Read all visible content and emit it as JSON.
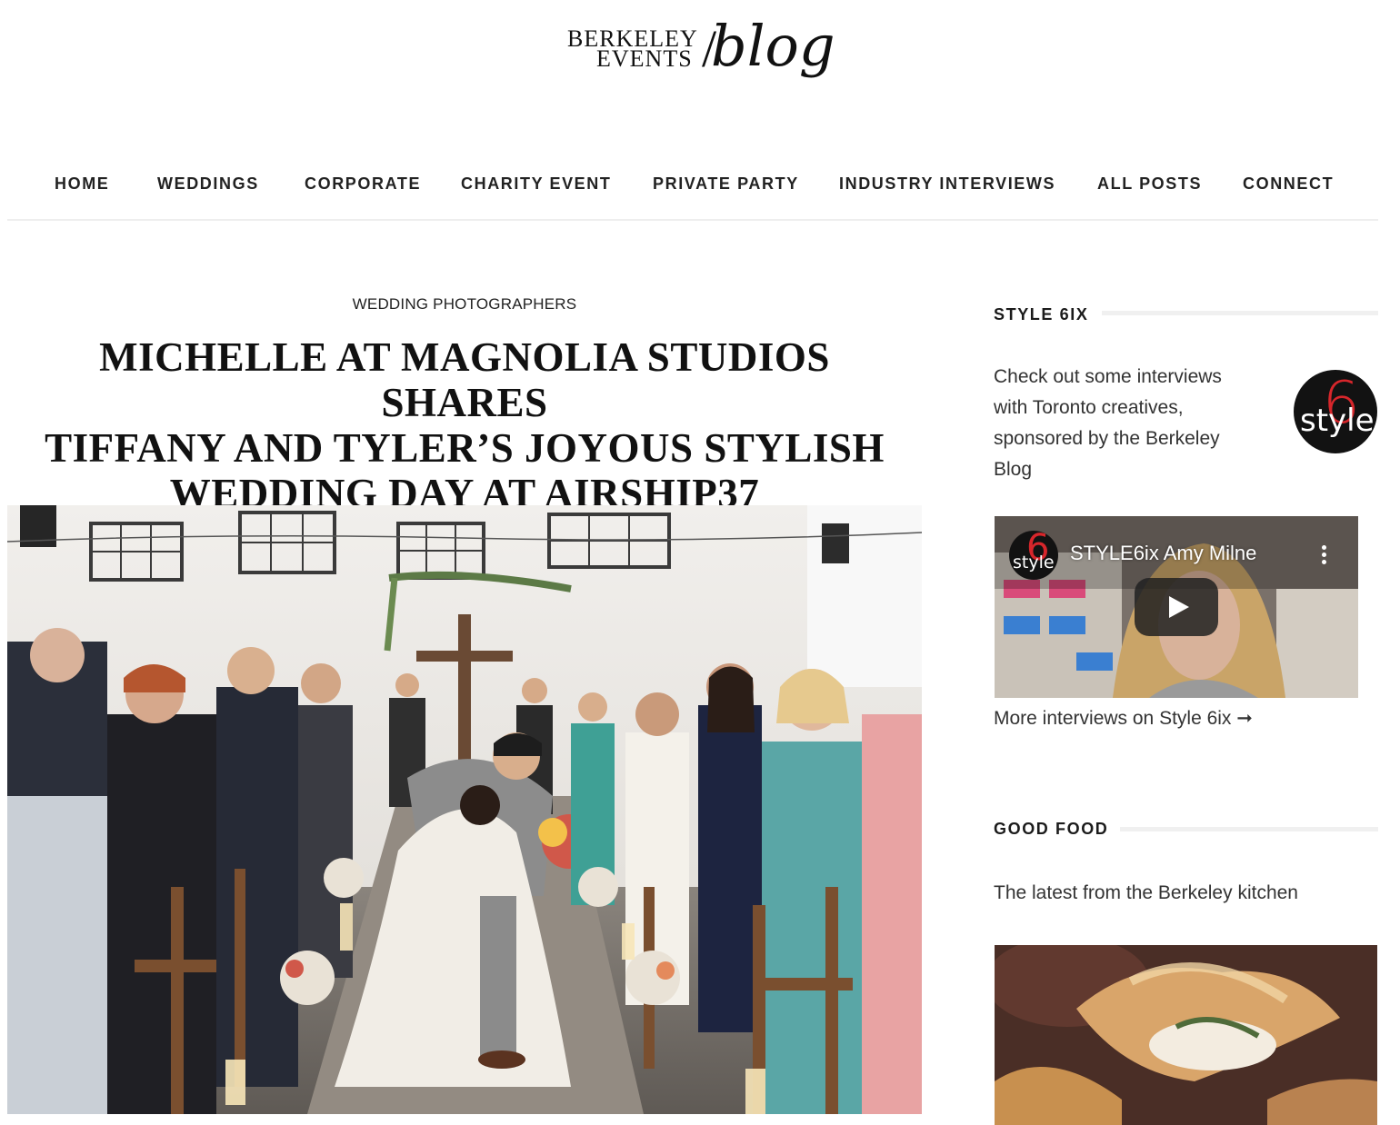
{
  "logo": {
    "line1": "BERKELEY",
    "line2": "EVENTS",
    "slash": "/",
    "script": "blog"
  },
  "nav": {
    "items": [
      {
        "label": "HOME"
      },
      {
        "label": "WEDDINGS"
      },
      {
        "label": "CORPORATE"
      },
      {
        "label": "CHARITY EVENT"
      },
      {
        "label": "PRIVATE PARTY"
      },
      {
        "label": "INDUSTRY INTERVIEWS"
      },
      {
        "label": "ALL POSTS"
      },
      {
        "label": "CONNECT"
      }
    ]
  },
  "article": {
    "category": "WEDDING PHOTOGRAPHERS",
    "title_lines": [
      "MICHELLE AT MAGNOLIA STUDIOS SHARES",
      "TIFFANY AND TYLER’S JOYOUS STYLISH",
      "WEDDING DAY AT AIRSHIP37"
    ]
  },
  "sidebar": {
    "style6ix": {
      "title": "STYLE 6IX",
      "description_lines": [
        "Check out some interviews",
        "with Toronto creatives,",
        "sponsored by the Berkeley",
        "Blog"
      ],
      "badge_six": "6",
      "badge_word": "style",
      "video_title": "STYLE6ix Amy Milne",
      "more_link": "More interviews on Style 6ix ➞"
    },
    "good_food": {
      "title": "GOOD FOOD",
      "description": "The latest from the Berkeley kitchen"
    }
  },
  "colors": {
    "text": "#1b1b1b",
    "rule": "#eeeeee",
    "badge_red": "#d7262b",
    "badge_black": "#121212"
  }
}
